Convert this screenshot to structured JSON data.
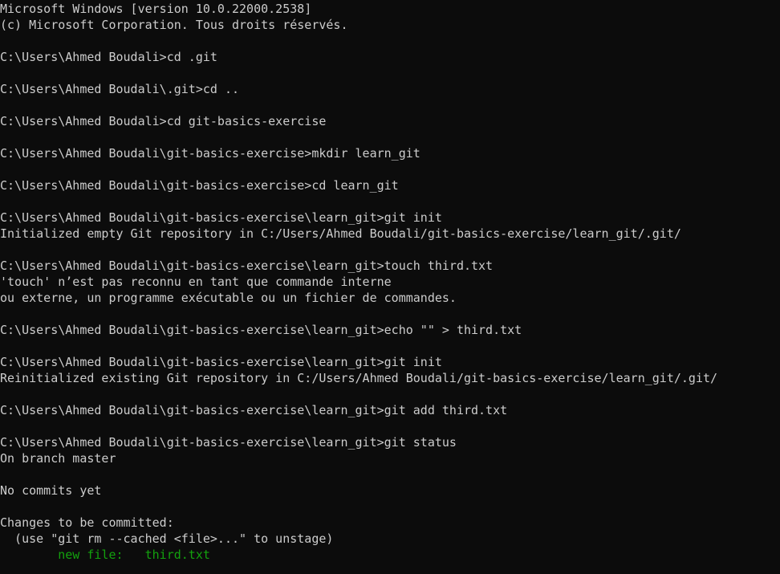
{
  "terminal": {
    "lines": [
      {
        "text": "Microsoft Windows [version 10.0.22000.2538]"
      },
      {
        "text": "(c) Microsoft Corporation. Tous droits réservés."
      },
      {
        "text": ""
      },
      {
        "text": "C:\\Users\\Ahmed Boudali>cd .git"
      },
      {
        "text": ""
      },
      {
        "text": "C:\\Users\\Ahmed Boudali\\.git>cd .."
      },
      {
        "text": ""
      },
      {
        "text": "C:\\Users\\Ahmed Boudali>cd git-basics-exercise"
      },
      {
        "text": ""
      },
      {
        "text": "C:\\Users\\Ahmed Boudali\\git-basics-exercise>mkdir learn_git"
      },
      {
        "text": ""
      },
      {
        "text": "C:\\Users\\Ahmed Boudali\\git-basics-exercise>cd learn_git"
      },
      {
        "text": ""
      },
      {
        "text": "C:\\Users\\Ahmed Boudali\\git-basics-exercise\\learn_git>git init"
      },
      {
        "text": "Initialized empty Git repository in C:/Users/Ahmed Boudali/git-basics-exercise/learn_git/.git/"
      },
      {
        "text": ""
      },
      {
        "text": "C:\\Users\\Ahmed Boudali\\git-basics-exercise\\learn_git>touch third.txt"
      },
      {
        "text": "'touch' n’est pas reconnu en tant que commande interne"
      },
      {
        "text": "ou externe, un programme exécutable ou un fichier de commandes."
      },
      {
        "text": ""
      },
      {
        "text": "C:\\Users\\Ahmed Boudali\\git-basics-exercise\\learn_git>echo \"\" > third.txt"
      },
      {
        "text": ""
      },
      {
        "text": "C:\\Users\\Ahmed Boudali\\git-basics-exercise\\learn_git>git init"
      },
      {
        "text": "Reinitialized existing Git repository in C:/Users/Ahmed Boudali/git-basics-exercise/learn_git/.git/"
      },
      {
        "text": ""
      },
      {
        "text": "C:\\Users\\Ahmed Boudali\\git-basics-exercise\\learn_git>git add third.txt"
      },
      {
        "text": ""
      },
      {
        "text": "C:\\Users\\Ahmed Boudali\\git-basics-exercise\\learn_git>git status"
      },
      {
        "text": "On branch master"
      },
      {
        "text": ""
      },
      {
        "text": "No commits yet"
      },
      {
        "text": ""
      },
      {
        "text": "Changes to be committed:"
      },
      {
        "text": "  (use \"git rm --cached <file>...\" to unstage)"
      },
      {
        "text": "        new file:   third.txt",
        "color": "green"
      }
    ]
  },
  "colors": {
    "background": "#0c0c0c",
    "text": "#cccccc",
    "staged_green": "#13a10e"
  }
}
